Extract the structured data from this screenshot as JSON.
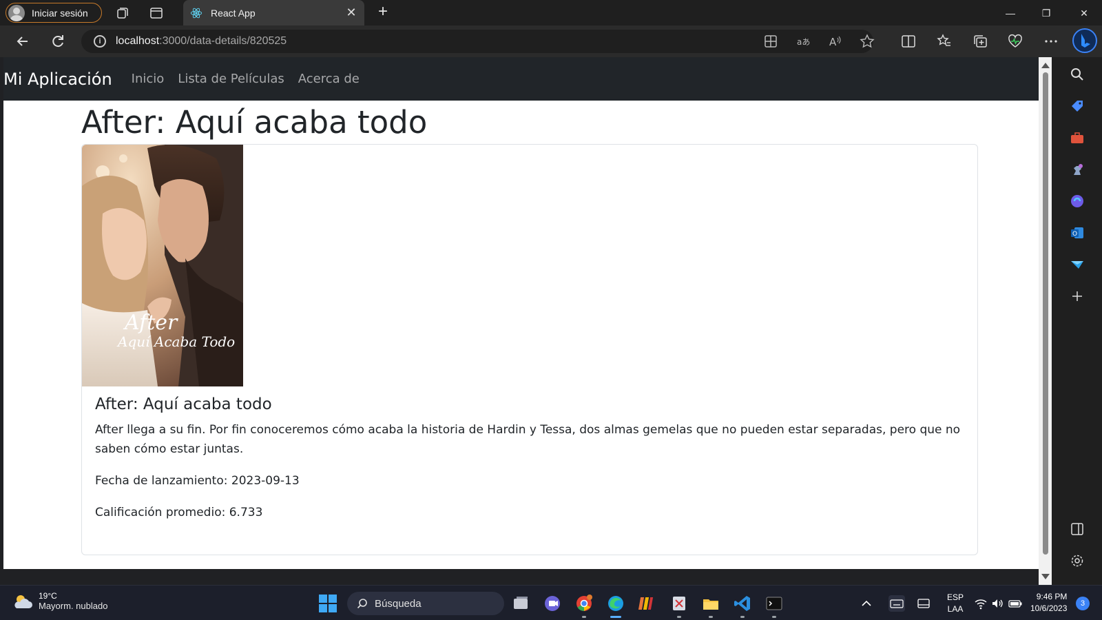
{
  "browser": {
    "profile_label": "Iniciar sesión",
    "tab_title": "React App",
    "url_host": "localhost",
    "url_path": ":3000/data-details/820525"
  },
  "app": {
    "brand": "Mi Aplicación",
    "nav": [
      "Inicio",
      "Lista de Películas",
      "Acerca de"
    ]
  },
  "movie": {
    "page_title": "After: Aquí acaba todo",
    "card_title": "After: Aquí acaba todo",
    "overview": "After llega a su fin. Por fin conoceremos cómo acaba la historia de Hardin y Tessa, dos almas gemelas que no pueden estar separadas, pero que no saben cómo estar juntas.",
    "release_label": "Fecha de lanzamiento: 2023-09-13",
    "rating_label": "Calificación promedio: 6.733",
    "poster_caption_line1": "After",
    "poster_caption_line2": "Aquí Acaba Todo"
  },
  "taskbar": {
    "temperature": "19°C",
    "weather": "Mayorm. nublado",
    "search_placeholder": "Búsqueda",
    "lang_line1": "ESP",
    "lang_line2": "LAA",
    "time": "9:46 PM",
    "date": "10/6/2023",
    "notification_count": "3"
  }
}
